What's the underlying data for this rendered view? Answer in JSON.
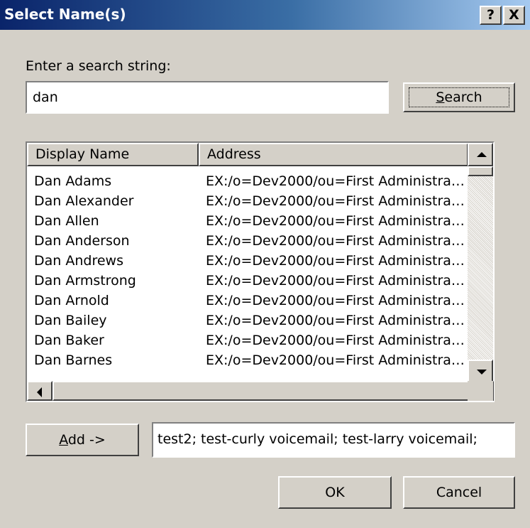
{
  "dialog": {
    "title": "Select Name(s)",
    "help_btn": "?",
    "close_btn": "X"
  },
  "search": {
    "label": "Enter a search string:",
    "value": "dan",
    "button_label_accel": "S",
    "button_label_rest": "earch"
  },
  "list": {
    "columns": [
      "Display Name",
      "Address"
    ],
    "rows": [
      {
        "name": "Dan Adams",
        "address": "EX:/o=Dev2000/ou=First Administra…"
      },
      {
        "name": "Dan Alexander",
        "address": "EX:/o=Dev2000/ou=First Administra…"
      },
      {
        "name": "Dan Allen",
        "address": "EX:/o=Dev2000/ou=First Administra…"
      },
      {
        "name": "Dan Anderson",
        "address": "EX:/o=Dev2000/ou=First Administra…"
      },
      {
        "name": "Dan Andrews",
        "address": "EX:/o=Dev2000/ou=First Administra…"
      },
      {
        "name": "Dan Armstrong",
        "address": "EX:/o=Dev2000/ou=First Administra…"
      },
      {
        "name": "Dan Arnold",
        "address": "EX:/o=Dev2000/ou=First Administra…"
      },
      {
        "name": "Dan Bailey",
        "address": "EX:/o=Dev2000/ou=First Administra…"
      },
      {
        "name": "Dan Baker",
        "address": "EX:/o=Dev2000/ou=First Administra…"
      },
      {
        "name": "Dan Barnes",
        "address": "EX:/o=Dev2000/ou=First Administra…"
      }
    ]
  },
  "add": {
    "button_accel": "A",
    "button_rest": "dd ->",
    "recipients": [
      "test2",
      "test-curly voicemail",
      "test-larry voicemail"
    ]
  },
  "footer": {
    "ok_label": "OK",
    "cancel_label": "Cancel"
  }
}
